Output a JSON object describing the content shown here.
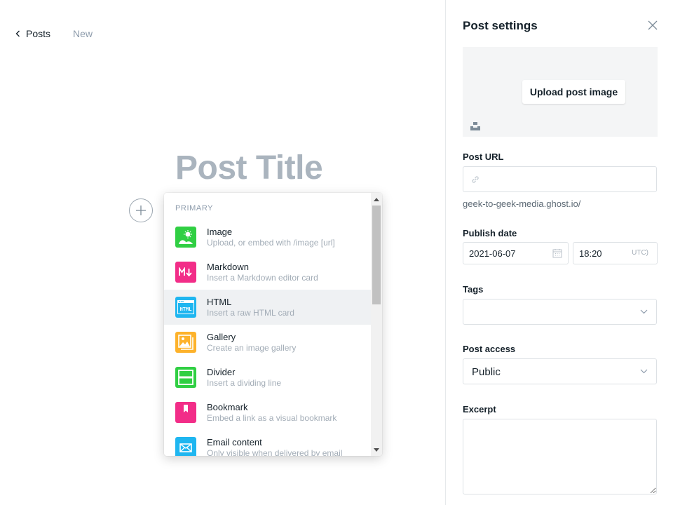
{
  "editor": {
    "back_label": "Posts",
    "status": "New",
    "title_placeholder": "Post Title"
  },
  "card_menu": {
    "section_heading": "PRIMARY",
    "items": [
      {
        "label": "Image",
        "desc": "Upload, or embed with /image [url]",
        "icon": "image-icon",
        "color": "#30cf43"
      },
      {
        "label": "Markdown",
        "desc": "Insert a Markdown editor card",
        "icon": "markdown-icon",
        "color": "#f22d88"
      },
      {
        "label": "HTML",
        "desc": "Insert a raw HTML card",
        "icon": "html-icon",
        "color": "#1fb6f0"
      },
      {
        "label": "Gallery",
        "desc": "Create an image gallery",
        "icon": "gallery-icon",
        "color": "#fdb22b"
      },
      {
        "label": "Divider",
        "desc": "Insert a dividing line",
        "icon": "divider-icon",
        "color": "#30cf43"
      },
      {
        "label": "Bookmark",
        "desc": "Embed a link as a visual bookmark",
        "icon": "bookmark-icon",
        "color": "#f22d88"
      },
      {
        "label": "Email content",
        "desc": "Only visible when delivered by email",
        "icon": "email-icon",
        "color": "#1fb6f0"
      }
    ]
  },
  "settings": {
    "title": "Post settings",
    "upload_label": "Upload post image",
    "url_label": "Post URL",
    "url_value": "",
    "url_hint": "geek-to-geek-media.ghost.io/",
    "publish_label": "Publish date",
    "date_value": "2021-06-07",
    "time_value": "18:20",
    "timezone": "UTC)",
    "tags_label": "Tags",
    "access_label": "Post access",
    "access_value": "Public",
    "excerpt_label": "Excerpt",
    "excerpt_value": ""
  }
}
